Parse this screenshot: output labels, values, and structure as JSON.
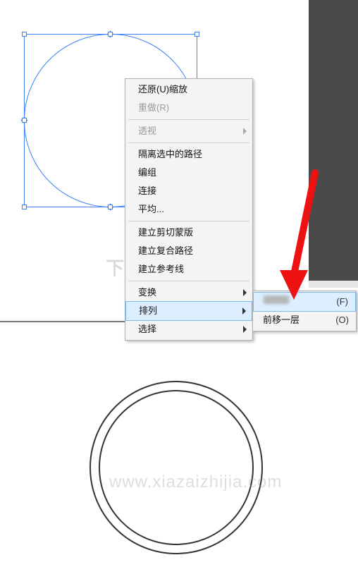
{
  "watermark_top": "下载之家",
  "watermark_url": "www.xiazaizhijia.com",
  "menu": {
    "undo": "还原(U)缩放",
    "redo": "重做(R)",
    "perspective": "透视",
    "isolate": "隔离选中的路径",
    "group": "编组",
    "join": "连接",
    "average": "平均...",
    "clip_mask": "建立剪切蒙版",
    "compound": "建立复合路径",
    "guides": "建立参考线",
    "transform": "变换",
    "arrange": "排列",
    "select": "选择"
  },
  "submenu": {
    "front_accelerator": "(F)",
    "forward_label": "前移一层",
    "forward_accelerator": "(O)"
  }
}
